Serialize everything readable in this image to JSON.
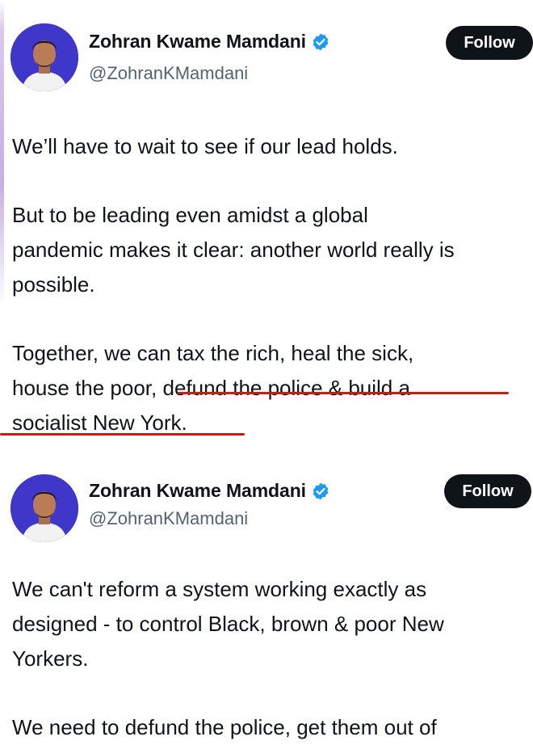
{
  "tweets": [
    {
      "author_name": "Zohran Kwame Mamdani",
      "handle": "@ZohranKMamdani",
      "follow_label": "Follow",
      "paragraphs": [
        [
          "We’ll have to wait to see if our lead holds."
        ],
        [
          "But to be leading even amidst a global",
          "pandemic makes it clear: another world really is",
          "possible."
        ],
        [
          "Together, we can tax the rich, heal the sick,",
          "house the poor, defund the police & build a",
          "socialist New York."
        ]
      ]
    },
    {
      "author_name": "Zohran Kwame Mamdani",
      "handle": "@ZohranKMamdani",
      "follow_label": "Follow",
      "paragraphs": [
        [
          "We can't reform a system working exactly as",
          "designed - to control Black, brown & poor New",
          "Yorkers."
        ],
        [
          "We need to defund the police, get them out of"
        ]
      ]
    }
  ],
  "icons": {
    "verified": "verified-badge-icon",
    "avatar": "profile-avatar"
  },
  "colors": {
    "verified": "#1d9bf0",
    "follow_bg": "#0f1419",
    "handle": "#536471",
    "underline": "#d41616",
    "avatar_bg": "#3f37c9"
  }
}
